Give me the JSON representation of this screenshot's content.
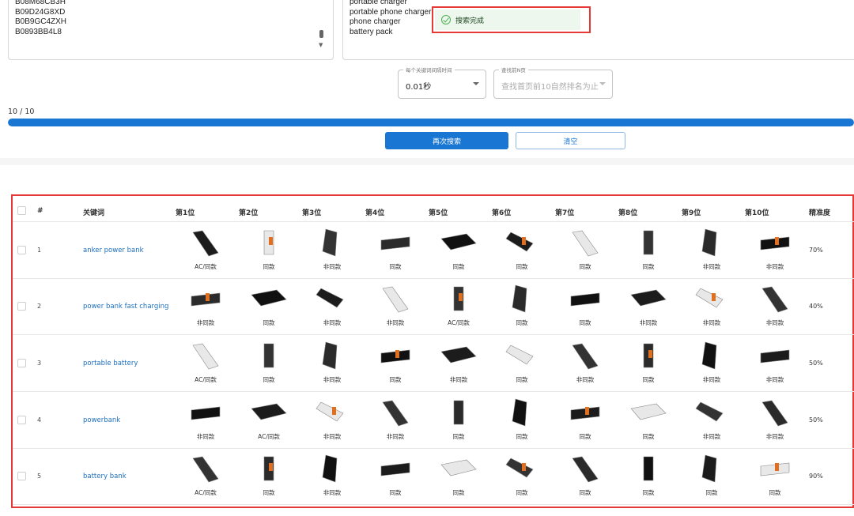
{
  "asin_list": [
    "B08M68CB3H",
    "B09D24G8XD",
    "B0B9GC4ZXH",
    "B0893BB4L8"
  ],
  "keyword_list": [
    "portable charger",
    "portable phone charger",
    "phone charger",
    "battery pack"
  ],
  "toast": {
    "message": "搜索完成",
    "icon": "check-circle-icon",
    "color": "#4caf50"
  },
  "interval_select": {
    "label": "每个关键词间隔时间",
    "value": "0.01秒"
  },
  "pages_select": {
    "label": "查找前N页",
    "value": "查找首页前10自然排名为止"
  },
  "progress": {
    "text": "10 / 10",
    "fraction": 1.0
  },
  "buttons": {
    "search_again": "再次搜索",
    "clear": "清空"
  },
  "colors": {
    "primary": "#1976d2",
    "highlight_border": "#e53935",
    "keyword_link": "#1e6fbf"
  },
  "table": {
    "headers": [
      "#",
      "关键词",
      "第1位",
      "第2位",
      "第3位",
      "第4位",
      "第5位",
      "第6位",
      "第7位",
      "第8位",
      "第9位",
      "第10位",
      "精准度"
    ],
    "rows": [
      {
        "num": "1",
        "keyword": "anker power bank",
        "accuracy": "70%",
        "labels": [
          "AC/同款",
          "同款",
          "非同款",
          "同款",
          "同款",
          "同款",
          "同款",
          "同款",
          "非同款",
          "非同款"
        ]
      },
      {
        "num": "2",
        "keyword": "power bank fast charging",
        "accuracy": "40%",
        "labels": [
          "非同款",
          "同款",
          "非同款",
          "非同款",
          "AC/同款",
          "同款",
          "同款",
          "非同款",
          "非同款",
          "非同款"
        ]
      },
      {
        "num": "3",
        "keyword": "portable battery",
        "accuracy": "50%",
        "labels": [
          "AC/同款",
          "同款",
          "非同款",
          "同款",
          "非同款",
          "同款",
          "非同款",
          "同款",
          "非同款",
          "非同款"
        ]
      },
      {
        "num": "4",
        "keyword": "powerbank",
        "accuracy": "50%",
        "labels": [
          "非同款",
          "AC/同款",
          "非同款",
          "非同款",
          "同款",
          "同款",
          "同款",
          "同款",
          "非同款",
          "非同款"
        ]
      },
      {
        "num": "5",
        "keyword": "battery bank",
        "accuracy": "90%",
        "labels": [
          "AC/同款",
          "同款",
          "非同款",
          "同款",
          "同款",
          "同款",
          "同款",
          "同款",
          "同款",
          "同款"
        ]
      }
    ]
  }
}
